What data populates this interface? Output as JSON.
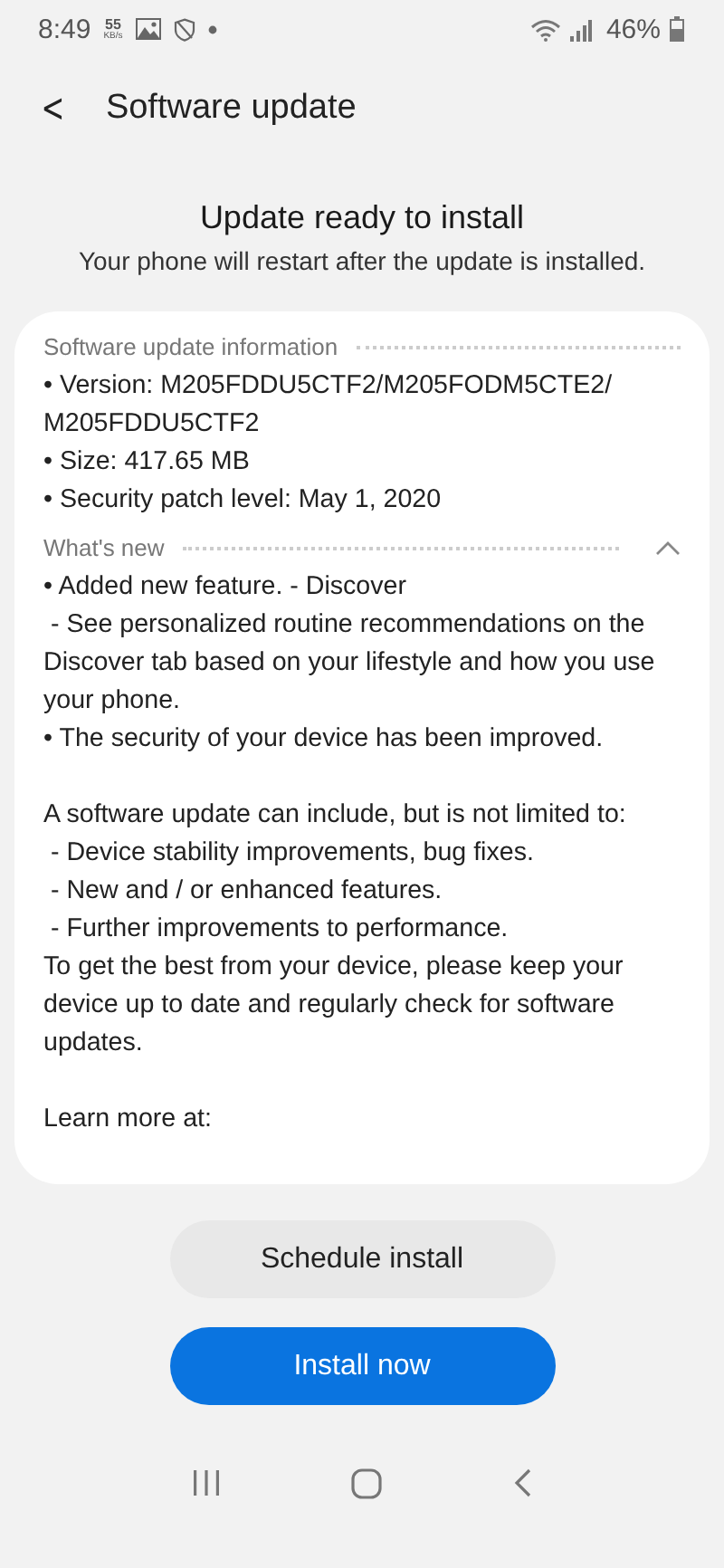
{
  "status_bar": {
    "time": "8:49",
    "speed_value": "55",
    "speed_unit": "KB/s",
    "battery": "46%"
  },
  "header": {
    "back_glyph": "<",
    "title": "Software update"
  },
  "headline": {
    "title": "Update ready to install",
    "subtitle": "Your phone will restart after the update is installed."
  },
  "info_section": {
    "title": "Software update information",
    "items": [
      "• Version: M205FDDU5CTF2/M205FODM5CTE2/ M205FDDU5CTF2",
      "• Size: 417.65 MB",
      "• Security patch level: May 1, 2020"
    ]
  },
  "whats_new": {
    "title": "What's new",
    "expanded": true,
    "paragraphs": [
      {
        "kind": "line",
        "text": "• Added new feature. - Discover"
      },
      {
        "kind": "line",
        "text": " - See personalized routine recommendations on the Discover tab based on your lifestyle and how you use your phone."
      },
      {
        "kind": "line",
        "text": "• The security of your device has been improved."
      },
      {
        "kind": "gap"
      },
      {
        "kind": "line",
        "text": "A software update can include, but is not limited to:"
      },
      {
        "kind": "line",
        "text": " - Device stability improvements, bug fixes."
      },
      {
        "kind": "line",
        "text": " - New and / or enhanced features."
      },
      {
        "kind": "line",
        "text": " - Further improvements to performance."
      },
      {
        "kind": "line",
        "text": "To get the best from your device, please keep your device up to date and regularly check for software updates."
      },
      {
        "kind": "gap"
      },
      {
        "kind": "line",
        "text": "Learn more at:"
      }
    ]
  },
  "buttons": [
    {
      "kind": "secondary",
      "label": "Schedule install"
    },
    {
      "kind": "primary",
      "label": "Install now"
    }
  ]
}
